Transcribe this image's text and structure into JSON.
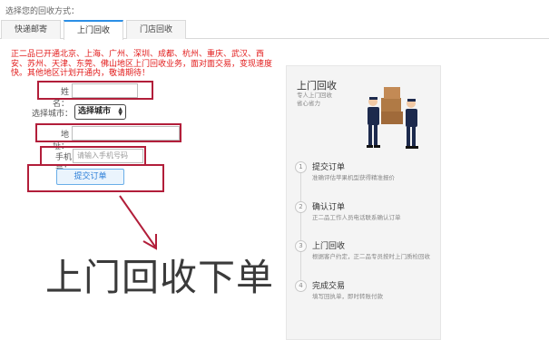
{
  "heading": "选择您的回收方式：",
  "tabs": [
    {
      "label": "快递邮寄"
    },
    {
      "label": "上门回收"
    },
    {
      "label": "门店回收"
    }
  ],
  "notice": "正二品已开通北京、上海、广州、深圳、成都、杭州、重庆、武汉、西安、苏州、天津、东莞、佛山地区上门回收业务，面对面交易，变现速度快。其他地区计划开通内，敬请期待！",
  "form": {
    "name_label": "姓名：",
    "city_label": "选择城市：",
    "city_value": "选择城市",
    "address_label": "地址：",
    "phone_label": "手机号：",
    "phone_placeholder": "请输入手机号码",
    "submit_label": "提交订单"
  },
  "annotation": "上门回收下单",
  "colors": {
    "accent": "#2b8fe6",
    "notice": "#e21b1b",
    "highlight": "#b21e3a"
  },
  "panel": {
    "title": "上门回收",
    "subtitle_line1": "专人上门回收",
    "subtitle_line2": "省心省力",
    "steps": [
      {
        "num": "1",
        "title": "提交订单",
        "desc": "准确评估苹果机型获得精准报价"
      },
      {
        "num": "2",
        "title": "确认订单",
        "desc": "正二品工作人员电话联系确认订单"
      },
      {
        "num": "3",
        "title": "上门回收",
        "desc": "根据客户约定，正二品专员按时上门质检回收"
      },
      {
        "num": "4",
        "title": "完成交易",
        "desc": "填写回执单，即时转账付款"
      }
    ]
  }
}
